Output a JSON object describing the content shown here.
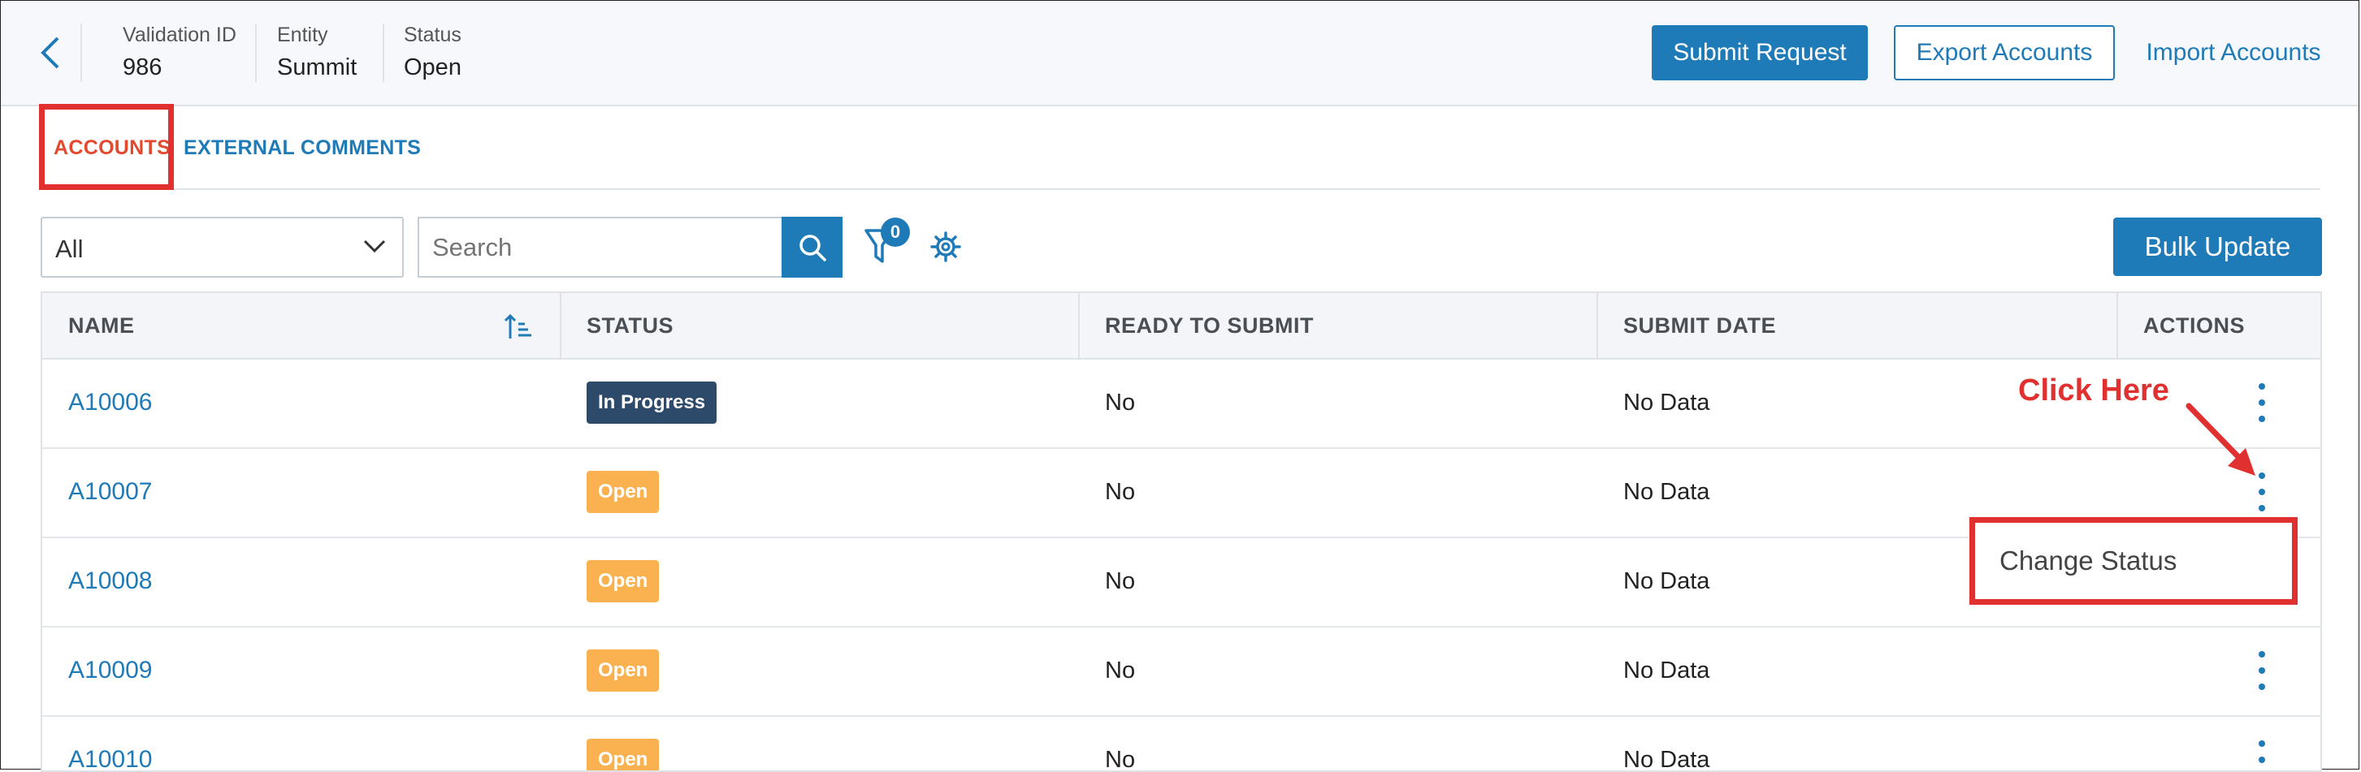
{
  "header": {
    "meta": [
      {
        "label": "Validation ID",
        "value": "986"
      },
      {
        "label": "Entity",
        "value": "Summit"
      },
      {
        "label": "Status",
        "value": "Open"
      }
    ],
    "submit_label": "Submit Request",
    "export_label": "Export Accounts",
    "import_label": "Import Accounts"
  },
  "tabs": [
    {
      "label": "ACCOUNTS",
      "active": true
    },
    {
      "label": "EXTERNAL COMMENTS",
      "active": false
    }
  ],
  "toolbar": {
    "select_value": "All",
    "search_placeholder": "Search",
    "filter_count": "0",
    "bulk_update_label": "Bulk Update"
  },
  "table": {
    "columns": [
      "NAME",
      "STATUS",
      "READY TO SUBMIT",
      "SUBMIT DATE",
      "ACTIONS"
    ],
    "rows": [
      {
        "name": "A10006",
        "status": "In Progress",
        "ready": "No",
        "submit_date": "No Data"
      },
      {
        "name": "A10007",
        "status": "Open",
        "ready": "No",
        "submit_date": "No Data"
      },
      {
        "name": "A10008",
        "status": "Open",
        "ready": "No",
        "submit_date": "No Data"
      },
      {
        "name": "A10009",
        "status": "Open",
        "ready": "No",
        "submit_date": "No Data"
      },
      {
        "name": "A10010",
        "status": "Open",
        "ready": "No",
        "submit_date": "No Data"
      }
    ]
  },
  "annotation": {
    "click_here": "Click Here",
    "menu_item": "Change Status"
  },
  "colors": {
    "accent": "#1f7ab8",
    "active_tab": "#e2492f",
    "highlight": "#e03030",
    "badge_in_progress": "#2d4a6b",
    "badge_open": "#f9b24f"
  },
  "icons": [
    "back-chevron-icon",
    "chevron-down-icon",
    "search-icon",
    "filter-icon",
    "gear-icon",
    "sort-icon",
    "kebab-menu-icon",
    "arrow-icon"
  ]
}
